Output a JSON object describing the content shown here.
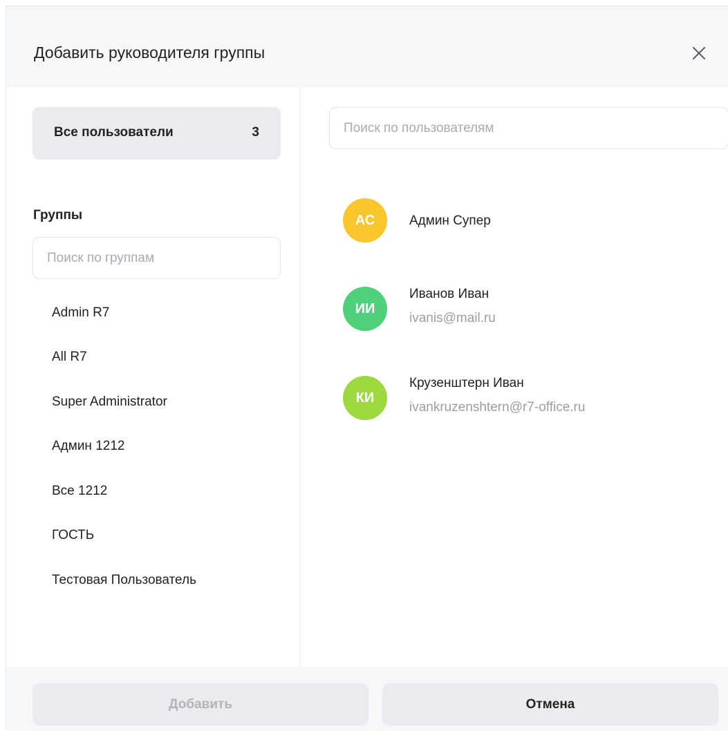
{
  "dialog": {
    "title": "Добавить руководителя группы",
    "close_icon": "close-icon"
  },
  "sidebar": {
    "all_users_label": "Все пользователи",
    "all_users_count": "3",
    "groups_heading": "Группы",
    "group_search_placeholder": "Поиск по группам",
    "groups": [
      {
        "label": "Admin R7"
      },
      {
        "label": "All R7"
      },
      {
        "label": "Super Administrator"
      },
      {
        "label": "Админ 1212"
      },
      {
        "label": "Все 1212"
      },
      {
        "label": "ГОСТЬ"
      },
      {
        "label": "Тестовая Пользователь"
      }
    ]
  },
  "main": {
    "user_search_placeholder": "Поиск по пользователям",
    "users": [
      {
        "initials": "АС",
        "name": "Админ Супер",
        "email": "",
        "avatar_color": "#f9c62b"
      },
      {
        "initials": "ИИ",
        "name": "Иванов Иван",
        "email": "ivanis@mail.ru",
        "avatar_color": "#4fd07a"
      },
      {
        "initials": "КИ",
        "name": "Крузенштерн Иван",
        "email": "ivankruzenshtern@r7-office.ru",
        "avatar_color": "#9bd93f"
      }
    ]
  },
  "footer": {
    "add_label": "Добавить",
    "cancel_label": "Отмена"
  }
}
